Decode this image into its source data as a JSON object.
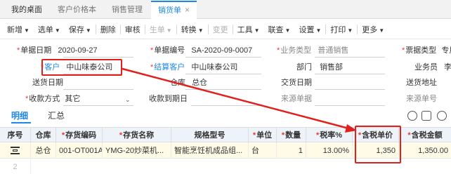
{
  "tabs": [
    {
      "label": "我的桌面"
    },
    {
      "label": "客户价格本"
    },
    {
      "label": "销售管理"
    },
    {
      "label": "销货单",
      "close": "×"
    }
  ],
  "toolbar": {
    "new": "新增",
    "select": "选单",
    "save": "保存",
    "delete": "删除",
    "audit": "审核",
    "gen": "生单",
    "convert": "转换",
    "change": "变更",
    "tools": "工具",
    "link": "联查",
    "settings": "设置",
    "print": "打印",
    "more": "更多"
  },
  "form": {
    "doc_date_label": "单据日期",
    "doc_date": "2020-09-27",
    "doc_no_label": "单据编号",
    "doc_no": "SA-2020-09-0007",
    "biz_type_label": "业务类型",
    "biz_type": "普通销售",
    "ticket_type_label": "票据类型",
    "ticket_type": "专用",
    "customer_label": "客户",
    "customer": "中山味泰公司",
    "settle_customer_label": "结算客户",
    "settle_customer": "中山味泰公司",
    "dept_label": "部门",
    "dept": "销售部",
    "salesman_label": "业务员",
    "salesman": "李彦",
    "delivery_date_label": "送货日期",
    "warehouse_label": "仓库",
    "warehouse": "总仓",
    "delivery_place_label": "交货日期",
    "delivery_addr_label": "送货地址",
    "pay_method_label": "收款方式",
    "pay_method": "其它",
    "receipt_due_label": "收款到期日",
    "source_doc_label": "来源单据",
    "source_no_label": "来源单号"
  },
  "subtabs": {
    "detail": "明细",
    "summary": "汇总"
  },
  "grid": {
    "headers": [
      "序号",
      "仓库",
      "存货编码",
      "存货名称",
      "规格型号",
      "单位",
      "数量",
      "税率%",
      "含税单价",
      "含税金额"
    ],
    "required": [
      false,
      false,
      true,
      true,
      false,
      true,
      true,
      true,
      true,
      true
    ],
    "row": {
      "idx": "1",
      "warehouse": "总仓",
      "code": "001-OT001A",
      "name": "YMG-20炒菜机...",
      "spec": "智能烹饪机成品组...",
      "unit": "台",
      "qty": "1",
      "tax_rate": "13.00%",
      "price_incl_tax": "1,350",
      "amount_incl_tax": "1,350.00"
    },
    "row2_idx": "2"
  },
  "colors": {
    "accent": "#1e88e5",
    "annotation": "#e0201c",
    "required": "#e53935"
  }
}
